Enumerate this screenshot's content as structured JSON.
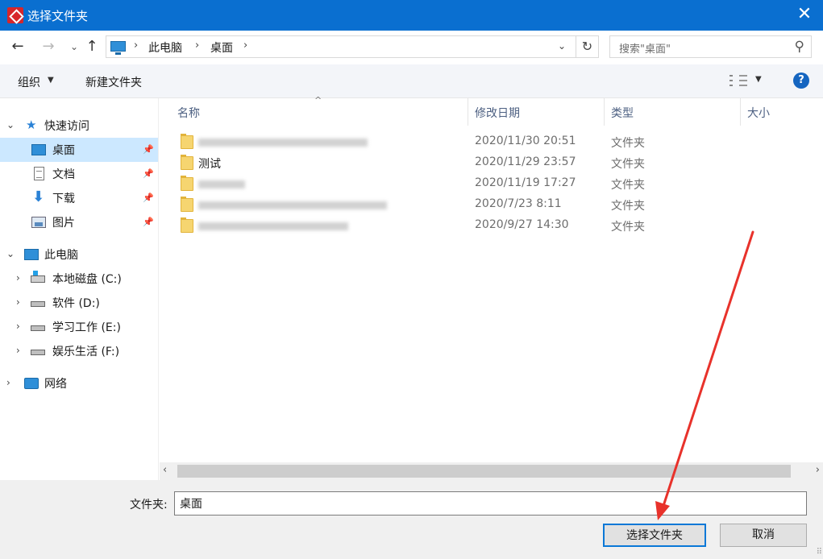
{
  "window": {
    "title": "选择文件夹",
    "close_glyph": "✕"
  },
  "nav": {
    "back_glyph": "←",
    "forward_glyph": "→",
    "recent_glyph": "⌄",
    "up_glyph": "↑",
    "breadcrumb": [
      "此电脑",
      "桌面"
    ],
    "crumb_sep": "›",
    "dropdown_glyph": "⌄",
    "refresh_glyph": "↻",
    "search_placeholder": "搜索\"桌面\"",
    "search_glyph": "⚲"
  },
  "toolbar": {
    "organize_label": "组织",
    "dropdown_glyph": "▼",
    "new_folder_label": "新建文件夹",
    "help_glyph": "?"
  },
  "sidebar": {
    "quick_access": {
      "label": "快速访问",
      "items": [
        {
          "label": "桌面",
          "icon": "desktop-icon",
          "pinned": true,
          "selected": true
        },
        {
          "label": "文档",
          "icon": "documents-icon",
          "pinned": true
        },
        {
          "label": "下载",
          "icon": "download-icon",
          "pinned": true
        },
        {
          "label": "图片",
          "icon": "pictures-icon",
          "pinned": true
        }
      ]
    },
    "this_pc": {
      "label": "此电脑",
      "drives": [
        {
          "label": "本地磁盘 (C:)"
        },
        {
          "label": "软件 (D:)"
        },
        {
          "label": "学习工作 (E:)"
        },
        {
          "label": "娱乐生活 (F:)"
        }
      ]
    },
    "network": {
      "label": "网络"
    },
    "expanded_glyph": "⌄",
    "collapsed_glyph": "›",
    "pin_glyph": "📌",
    "star_glyph": "★",
    "download_glyph": "⬇"
  },
  "file_list": {
    "columns": [
      "名称",
      "修改日期",
      "类型",
      "大小"
    ],
    "sort_glyph": "^",
    "rows": [
      {
        "name": "",
        "date": "2020/11/30 20:51",
        "type": "文件夹"
      },
      {
        "name": "测试",
        "date": "2020/11/29 23:57",
        "type": "文件夹"
      },
      {
        "name": "",
        "date": "2020/11/19 17:27",
        "type": "文件夹"
      },
      {
        "name": "",
        "date": "2020/7/23 8:11",
        "type": "文件夹"
      },
      {
        "name": "",
        "date": "2020/9/27 14:30",
        "type": "文件夹"
      }
    ]
  },
  "scrollbar": {
    "left_glyph": "‹",
    "right_glyph": "›"
  },
  "footer": {
    "folder_label": "文件夹:",
    "folder_value": "桌面",
    "select_button": "选择文件夹",
    "cancel_button": "取消",
    "grip_glyph": "⠿"
  },
  "colors": {
    "titlebar": "#0a6fd0",
    "selection": "#cce8ff",
    "annotation_arrow": "#e8322b"
  }
}
